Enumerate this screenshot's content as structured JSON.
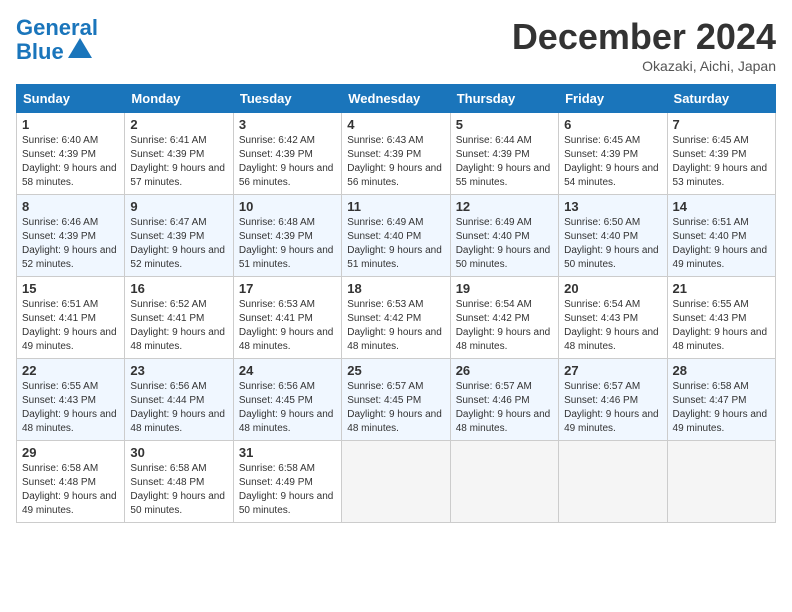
{
  "header": {
    "logo_line1": "General",
    "logo_line2": "Blue",
    "month": "December 2024",
    "location": "Okazaki, Aichi, Japan"
  },
  "days_of_week": [
    "Sunday",
    "Monday",
    "Tuesday",
    "Wednesday",
    "Thursday",
    "Friday",
    "Saturday"
  ],
  "weeks": [
    [
      {
        "day": 1,
        "rise": "6:40 AM",
        "set": "4:39 PM",
        "daylight": "9 hours and 58 minutes."
      },
      {
        "day": 2,
        "rise": "6:41 AM",
        "set": "4:39 PM",
        "daylight": "9 hours and 57 minutes."
      },
      {
        "day": 3,
        "rise": "6:42 AM",
        "set": "4:39 PM",
        "daylight": "9 hours and 56 minutes."
      },
      {
        "day": 4,
        "rise": "6:43 AM",
        "set": "4:39 PM",
        "daylight": "9 hours and 56 minutes."
      },
      {
        "day": 5,
        "rise": "6:44 AM",
        "set": "4:39 PM",
        "daylight": "9 hours and 55 minutes."
      },
      {
        "day": 6,
        "rise": "6:45 AM",
        "set": "4:39 PM",
        "daylight": "9 hours and 54 minutes."
      },
      {
        "day": 7,
        "rise": "6:45 AM",
        "set": "4:39 PM",
        "daylight": "9 hours and 53 minutes."
      }
    ],
    [
      {
        "day": 8,
        "rise": "6:46 AM",
        "set": "4:39 PM",
        "daylight": "9 hours and 52 minutes."
      },
      {
        "day": 9,
        "rise": "6:47 AM",
        "set": "4:39 PM",
        "daylight": "9 hours and 52 minutes."
      },
      {
        "day": 10,
        "rise": "6:48 AM",
        "set": "4:39 PM",
        "daylight": "9 hours and 51 minutes."
      },
      {
        "day": 11,
        "rise": "6:49 AM",
        "set": "4:40 PM",
        "daylight": "9 hours and 51 minutes."
      },
      {
        "day": 12,
        "rise": "6:49 AM",
        "set": "4:40 PM",
        "daylight": "9 hours and 50 minutes."
      },
      {
        "day": 13,
        "rise": "6:50 AM",
        "set": "4:40 PM",
        "daylight": "9 hours and 50 minutes."
      },
      {
        "day": 14,
        "rise": "6:51 AM",
        "set": "4:40 PM",
        "daylight": "9 hours and 49 minutes."
      }
    ],
    [
      {
        "day": 15,
        "rise": "6:51 AM",
        "set": "4:41 PM",
        "daylight": "9 hours and 49 minutes."
      },
      {
        "day": 16,
        "rise": "6:52 AM",
        "set": "4:41 PM",
        "daylight": "9 hours and 48 minutes."
      },
      {
        "day": 17,
        "rise": "6:53 AM",
        "set": "4:41 PM",
        "daylight": "9 hours and 48 minutes."
      },
      {
        "day": 18,
        "rise": "6:53 AM",
        "set": "4:42 PM",
        "daylight": "9 hours and 48 minutes."
      },
      {
        "day": 19,
        "rise": "6:54 AM",
        "set": "4:42 PM",
        "daylight": "9 hours and 48 minutes."
      },
      {
        "day": 20,
        "rise": "6:54 AM",
        "set": "4:43 PM",
        "daylight": "9 hours and 48 minutes."
      },
      {
        "day": 21,
        "rise": "6:55 AM",
        "set": "4:43 PM",
        "daylight": "9 hours and 48 minutes."
      }
    ],
    [
      {
        "day": 22,
        "rise": "6:55 AM",
        "set": "4:43 PM",
        "daylight": "9 hours and 48 minutes."
      },
      {
        "day": 23,
        "rise": "6:56 AM",
        "set": "4:44 PM",
        "daylight": "9 hours and 48 minutes."
      },
      {
        "day": 24,
        "rise": "6:56 AM",
        "set": "4:45 PM",
        "daylight": "9 hours and 48 minutes."
      },
      {
        "day": 25,
        "rise": "6:57 AM",
        "set": "4:45 PM",
        "daylight": "9 hours and 48 minutes."
      },
      {
        "day": 26,
        "rise": "6:57 AM",
        "set": "4:46 PM",
        "daylight": "9 hours and 48 minutes."
      },
      {
        "day": 27,
        "rise": "6:57 AM",
        "set": "4:46 PM",
        "daylight": "9 hours and 49 minutes."
      },
      {
        "day": 28,
        "rise": "6:58 AM",
        "set": "4:47 PM",
        "daylight": "9 hours and 49 minutes."
      }
    ],
    [
      {
        "day": 29,
        "rise": "6:58 AM",
        "set": "4:48 PM",
        "daylight": "9 hours and 49 minutes."
      },
      {
        "day": 30,
        "rise": "6:58 AM",
        "set": "4:48 PM",
        "daylight": "9 hours and 50 minutes."
      },
      {
        "day": 31,
        "rise": "6:58 AM",
        "set": "4:49 PM",
        "daylight": "9 hours and 50 minutes."
      },
      null,
      null,
      null,
      null
    ]
  ],
  "labels": {
    "sunrise": "Sunrise:",
    "sunset": "Sunset:",
    "daylight": "Daylight:"
  }
}
